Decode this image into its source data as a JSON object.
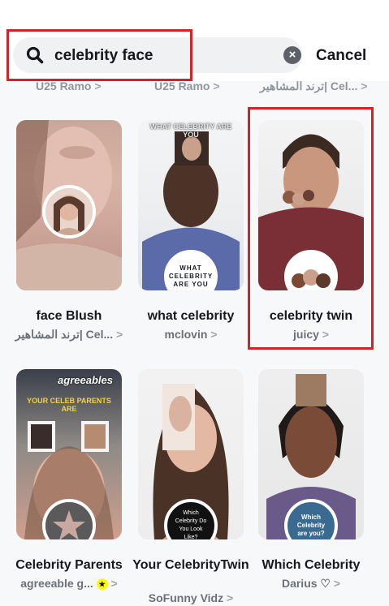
{
  "search": {
    "query": "celebrity face",
    "cancel_label": "Cancel"
  },
  "previous_row": [
    "U25 Ramo",
    "U25 Ramo",
    "ترند المشاهير| Cel..."
  ],
  "chevron": ">",
  "cards": [
    {
      "title": "face Blush",
      "creator": "ترند المشاهير| Cel...",
      "badge_text": ""
    },
    {
      "title": "what celebrity",
      "creator": "mclovin",
      "badge_text": "WHAT CELEBRITY ARE YOU",
      "thumb_text": "WHAT CELEBRITY ARE YOU"
    },
    {
      "title": "celebrity twin",
      "creator": "juicy",
      "badge_text": ""
    },
    {
      "title": "Celebrity Parents",
      "creator": "agreeable g...",
      "badge_text": "",
      "thumb_text": "agreeables",
      "thumb_text2": "YOUR CELEB PARENTS ARE"
    },
    {
      "title": "Your CelebrityTwin",
      "creator": "SoFunny Vidz",
      "badge_text": "Which Celebrity Do You Look Like?"
    },
    {
      "title": "Which Celebrity",
      "creator": "Darius ♡",
      "badge_text": "Which Celebrity are you?"
    }
  ],
  "colors": {
    "highlight": "#d2232a",
    "background": "#f7f8f9",
    "search_bg": "#eff1f3"
  }
}
